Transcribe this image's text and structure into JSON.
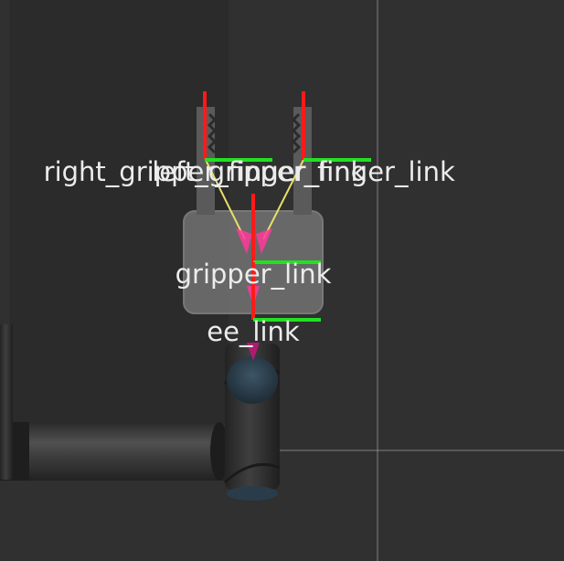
{
  "viewport": {
    "background_color": "#303030",
    "grid_color": "#9a9a9a"
  },
  "frames": {
    "right_gripper_finger_link": "right_gripper_finger_link",
    "left_gripper_finger_link": "left_gripper_finger_link",
    "gripper_link": "gripper_link",
    "ee_link": "ee_link"
  },
  "colors": {
    "x_axis": "#ff1a1a",
    "y_axis": "#22e022",
    "tf_arrow": "#ff3a9a",
    "tf_line": "#e6e066",
    "link_body": "#6b6b6b",
    "robot_dark": "#2c2c2c",
    "robot_cap": "#2e4556"
  }
}
